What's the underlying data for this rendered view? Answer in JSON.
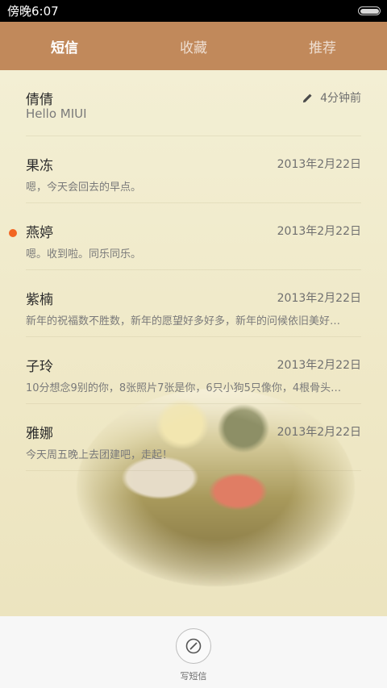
{
  "status_bar": {
    "time": "傍晚6:07"
  },
  "tabs": [
    {
      "label": "短信",
      "active": true
    },
    {
      "label": "收藏",
      "active": false
    },
    {
      "label": "推荐",
      "active": false
    }
  ],
  "conversations": [
    {
      "name": "倩倩",
      "snippet": "Hello MIUI",
      "time": "4分钟前",
      "draft": true,
      "unread": false
    },
    {
      "name": "果冻",
      "snippet": "嗯，今天会回去的早点。",
      "time": "2013年2月22日",
      "unread": false
    },
    {
      "name": "燕婷",
      "snippet": "嗯。收到啦。同乐同乐。",
      "time": "2013年2月22日",
      "unread": true
    },
    {
      "name": "紫楠",
      "snippet": "新年的祝福数不胜数，新年的愿望好多好多，新年的问候依旧美好…",
      "time": "2013年2月22日",
      "unread": false
    },
    {
      "name": "子玲",
      "snippet": "10分想念9别的你，8张照片7张是你，6只小狗5只像你，4根骨头…",
      "time": "2013年2月22日",
      "unread": false
    },
    {
      "name": "雅娜",
      "snippet": "今天周五晚上去团建吧，走起！",
      "time": "2013年2月22日",
      "unread": false
    }
  ],
  "compose": {
    "label": "写短信"
  },
  "colors": {
    "tab_bar": "#c1895b",
    "unread_dot": "#f26522",
    "background": "#efe8c6"
  }
}
